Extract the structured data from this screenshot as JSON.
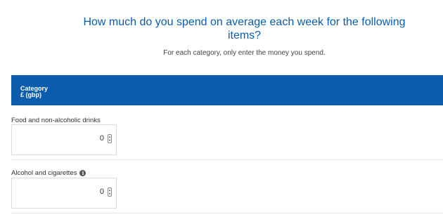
{
  "question": {
    "title": "How much do you spend on average each week for the following items?",
    "instruction": "For each category, only enter the money you spend."
  },
  "table_header": {
    "col1": "Category",
    "col2": "£ (gbp)"
  },
  "rows": [
    {
      "label": "Food and non-alcoholic drinks",
      "value": "0",
      "has_info_icon": false
    },
    {
      "label": "Alcohol and cigarettes",
      "value": "0",
      "has_info_icon": true
    }
  ],
  "colors": {
    "accent": "#0b5cad",
    "title_text": "#0a5dab"
  },
  "icons": [
    "info-icon",
    "spinner-up-icon",
    "spinner-down-icon"
  ]
}
